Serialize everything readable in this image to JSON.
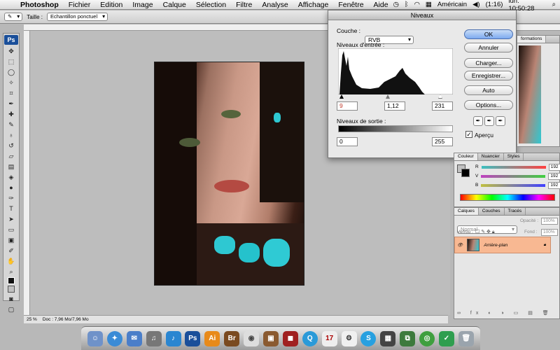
{
  "menubar": {
    "apple_icon": "apple-logo",
    "items": [
      "Photoshop",
      "Fichier",
      "Edition",
      "Image",
      "Calque",
      "Sélection",
      "Filtre",
      "Analyse",
      "Affichage",
      "Fenêtre",
      "Aide"
    ],
    "keyboard": "Américain",
    "battery": "(1:16)",
    "clock": "lun. 10:50:28"
  },
  "optbar": {
    "taille_label": "Taille :",
    "taille_value": "Echantillon ponctuel"
  },
  "status": {
    "zoom": "25 %",
    "doc": "Doc : 7,96 Mo/7,96 Mo"
  },
  "toolbox": {
    "badge": "Ps"
  },
  "levels": {
    "title": "Niveaux",
    "couche_label": "Couche :",
    "couche_value": "RVB",
    "input_label": "Niveaux d'entrée :",
    "input_black": "9",
    "input_gamma": "1,12",
    "input_white": "231",
    "output_label": "Niveaux de sortie :",
    "output_black": "0",
    "output_white": "255",
    "buttons": [
      "OK",
      "Annuler",
      "Charger...",
      "Enregistrer...",
      "Auto",
      "Options..."
    ],
    "apercu_label": "Aperçu",
    "apercu_checked": true
  },
  "color_panel": {
    "tabs": [
      "Couleur",
      "Nuancier",
      "Styles"
    ],
    "rows": [
      {
        "label": "R",
        "value": "192"
      },
      {
        "label": "V",
        "value": "192"
      },
      {
        "label": "B",
        "value": "192"
      }
    ]
  },
  "layers_panel": {
    "tabs": [
      "Calques",
      "Couches",
      "Tracés"
    ],
    "mode": "Normal",
    "opacity_label": "Opacité :",
    "opacity_value": "100%",
    "lock_label": "Verrou :",
    "fill_label": "Fond :",
    "fill_value": "100%",
    "layer_name": "Arrière-plan"
  },
  "history_panel": {
    "tab": "formations"
  },
  "dock": {
    "apps": [
      "Ai",
      "Br",
      "Ps"
    ]
  },
  "colors": {
    "accent": "#3b72d6",
    "layer_highlight": "#f8b892",
    "ps_blue": "#1a4f9a"
  }
}
